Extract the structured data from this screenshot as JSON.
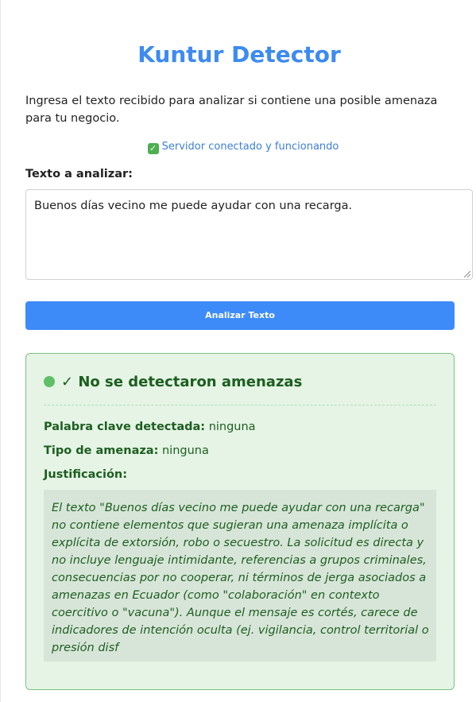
{
  "app": {
    "title": "Kuntur Detector",
    "intro": "Ingresa el texto recibido para analizar si contiene una posible amenaza para tu negocio.",
    "status": "Servidor conectado y funcionando",
    "status_icon": "check-box-icon"
  },
  "form": {
    "label": "Texto a analizar:",
    "text_value": "Buenos días vecino me puede ayudar con una recarga.",
    "button_label": "Analizar Texto"
  },
  "result": {
    "heading": "✓ No se detectaron amenazas",
    "status_color": "#5fbf66",
    "keyword_label": "Palabra clave detectada:",
    "keyword_value": "ninguna",
    "threat_type_label": "Tipo de amenaza:",
    "threat_type_value": "ninguna",
    "justification_label": "Justificación:",
    "justification_text": "El texto \"Buenos días vecino me puede ayudar con una recarga\" no contiene elementos que sugieran una amenaza implícita o explícita de extorsión, robo o secuestro. La solicitud es directa y no incluye lenguaje intimidante, referencias a grupos criminales, consecuencias por no cooperar, ni términos de jerga asociados a amenazas en Ecuador (como \"colaboración\" en contexto coercitivo o \"vacuna\"). Aunque el mensaje es cortés, carece de indicadores de intención oculta (ej. vigilancia, control territorial o presión disf"
  },
  "colors": {
    "accent": "#3d8bf0",
    "button": "#3d8bf8",
    "success_bg": "#e5f4e5",
    "success_border": "#7bc47f",
    "success_text": "#1d5e20"
  }
}
